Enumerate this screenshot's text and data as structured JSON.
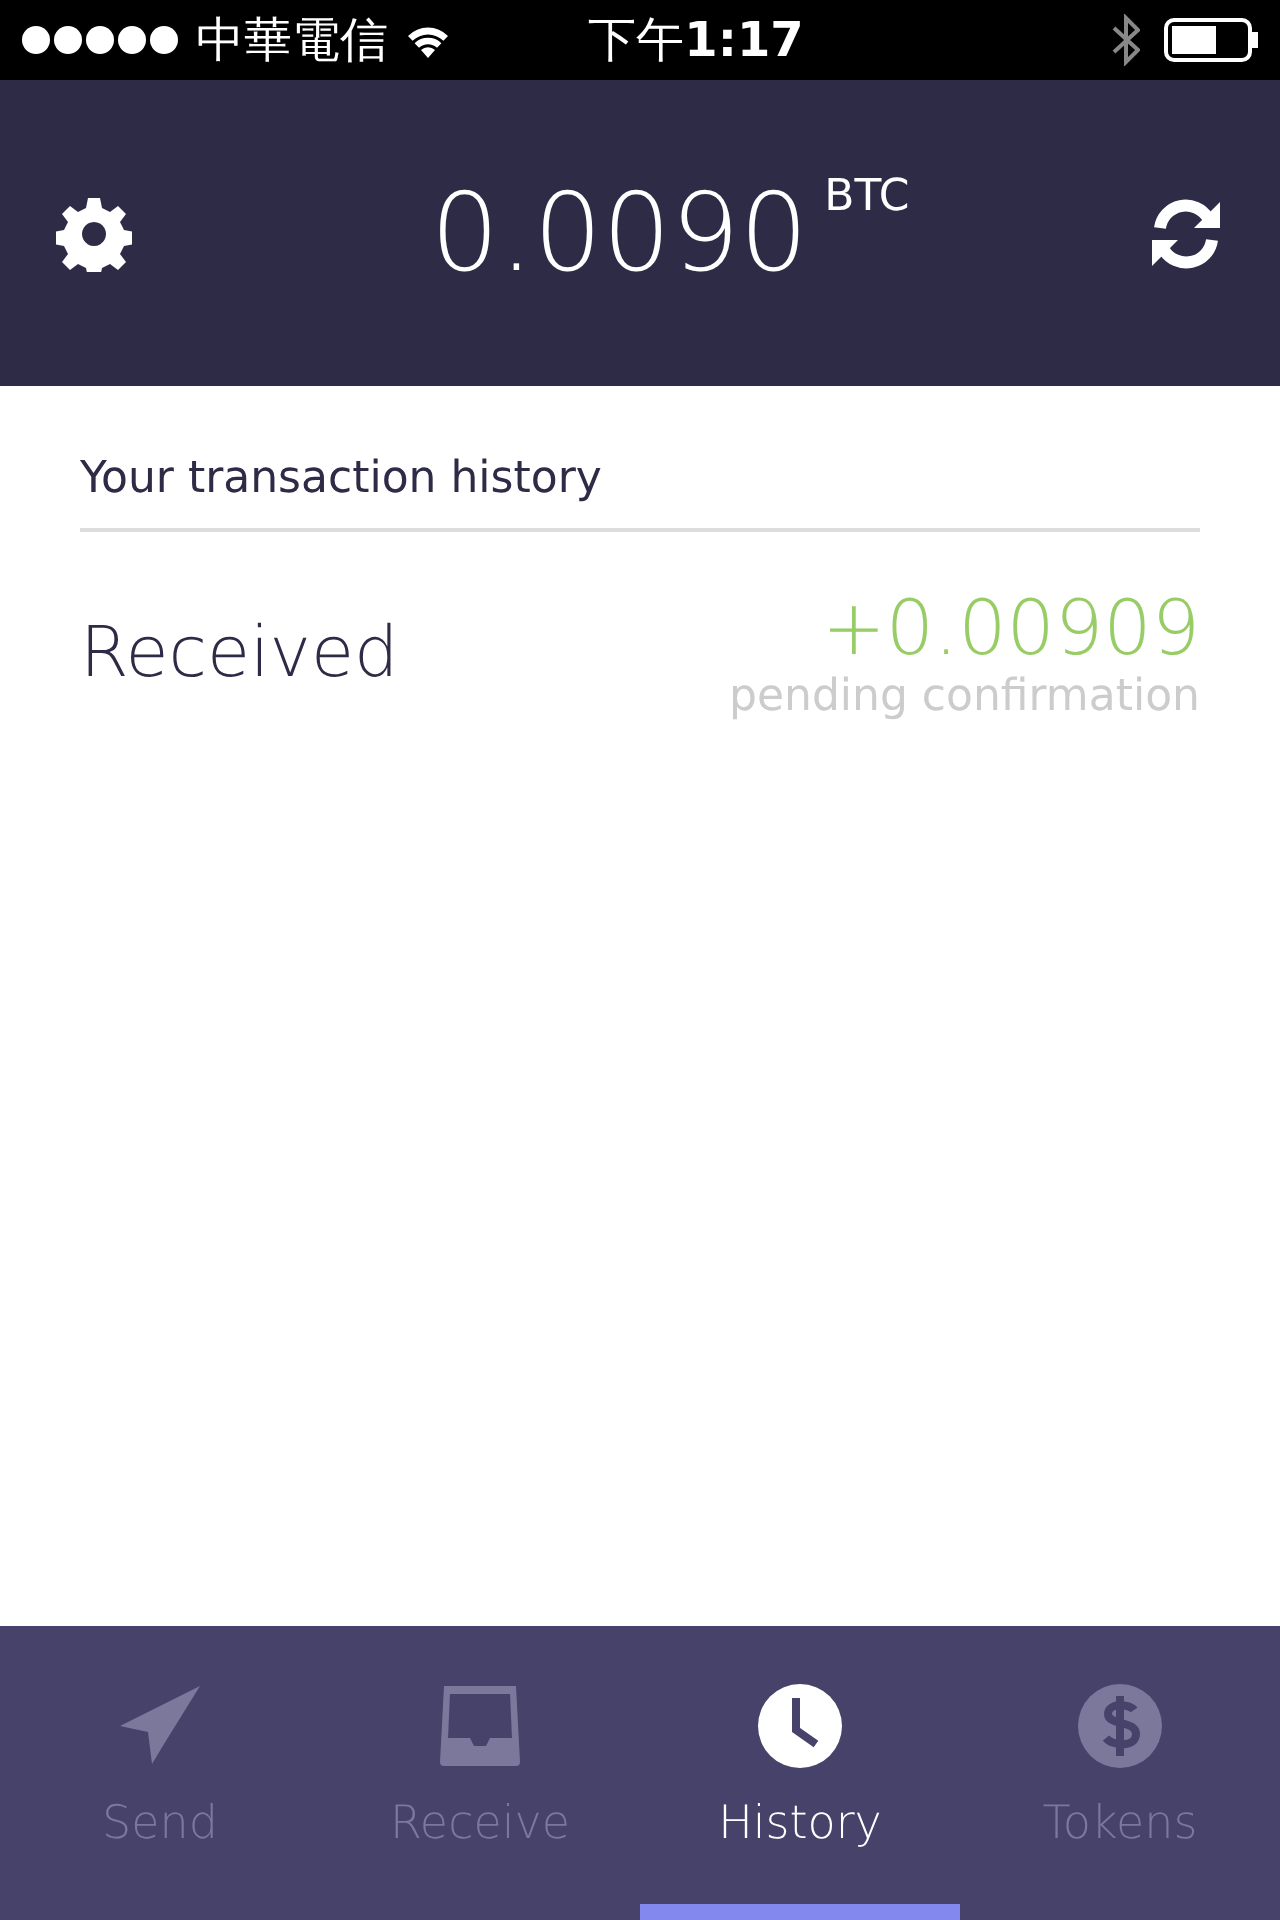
{
  "status_bar": {
    "carrier": "中華電信",
    "time": "下午**1:17**"
  },
  "header": {
    "balance": "0.0090",
    "unit": "BTC"
  },
  "history": {
    "title": "Your transaction history",
    "transactions": [
      {
        "label": "Received",
        "amount": "+0.00909",
        "status": "pending confirmation"
      }
    ]
  },
  "tabs": [
    {
      "kind": "send",
      "label": "Send",
      "selected": false
    },
    {
      "kind": "receive",
      "label": "Receive",
      "selected": false
    },
    {
      "kind": "history",
      "label": "History",
      "selected": true
    },
    {
      "kind": "tokens",
      "label": "Tokens",
      "selected": false
    }
  ]
}
